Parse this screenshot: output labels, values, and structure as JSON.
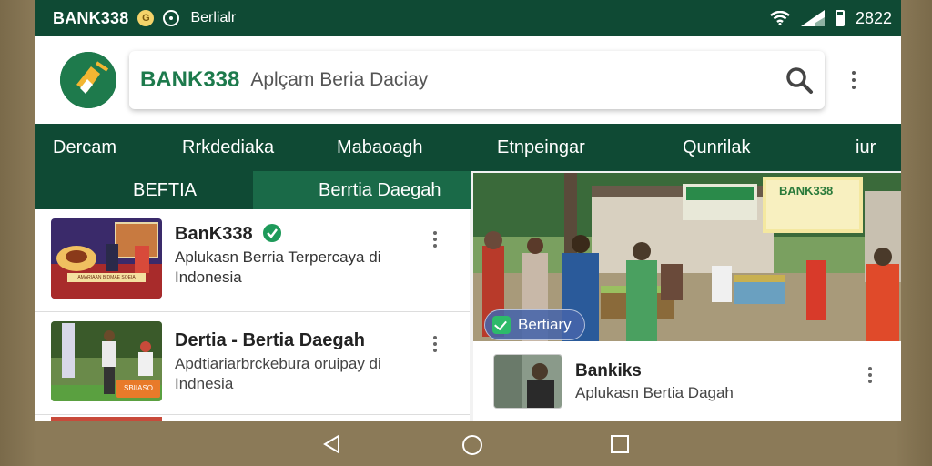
{
  "status_bar": {
    "brand": "BANK338",
    "g_badge": "G",
    "label": "Berlialr",
    "time": "2822"
  },
  "header": {
    "search_brand": "BANK338",
    "search_placeholder": "Aplçam Beria Daciay"
  },
  "nav": {
    "row1": [
      "Dercam",
      "Rrkdediaka",
      "Mabaoagh",
      "Etnpeingar",
      "Qunrilak",
      "iur"
    ],
    "row2": [
      "BEFTIA",
      "Berrtia Daegah"
    ],
    "row2_active": 1
  },
  "list": [
    {
      "title": "BanK338",
      "verified": true,
      "desc_line1": "Aplukasn Berria Terpercaya di",
      "desc_line2": "Indonesia",
      "thumb_caption": "AMARIAAN BIDMAE SOEIA"
    },
    {
      "title": "Dertia - Bertia Daegah",
      "desc_line1": "Apdtiariarbrckebura oruipay di",
      "desc_line2": "Indnesia",
      "thumb_tag": "SBIIASO"
    }
  ],
  "hero": {
    "banner": "BANK338",
    "badge": "Bertiary"
  },
  "card2": {
    "title": "Bankiks",
    "desc": "Aplukasn Bertia Dagah"
  },
  "colors": {
    "primary_dark": "#0f4a34",
    "brand_green": "#1d7a4c",
    "verified": "#1e9a5a"
  },
  "icons": {
    "search": "search-icon",
    "more": "more-vert-icon",
    "back": "back-triangle-icon",
    "home": "home-circle-icon",
    "recents": "recents-square-icon"
  }
}
